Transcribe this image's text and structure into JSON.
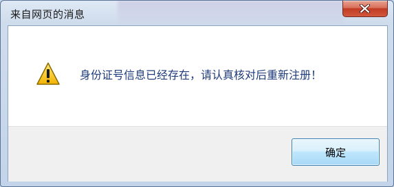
{
  "window": {
    "title": "来自网页的消息"
  },
  "dialog": {
    "message": "身份证号信息已经存在，请认真核对后重新注册！",
    "icon": "warning-icon"
  },
  "buttons": {
    "ok_label": "确定"
  },
  "colors": {
    "message_text": "#1e3a7a",
    "close_button": "#c13b24",
    "ok_button_border": "#3c7fb1"
  }
}
